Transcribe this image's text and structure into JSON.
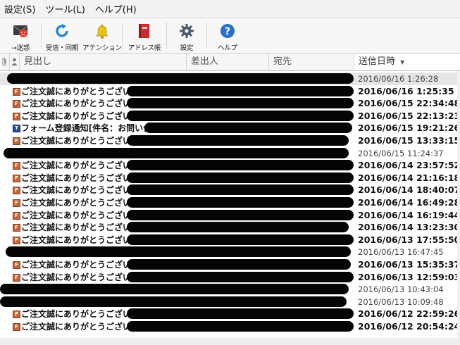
{
  "menu": [
    {
      "label": "設定(S)"
    },
    {
      "label": "ツール(L)"
    },
    {
      "label": "ヘルプ(H)"
    }
  ],
  "toolbar": [
    {
      "label": "→迷惑",
      "icon": "spam-mail-icon",
      "width": 58
    },
    {
      "label": "受信・同期",
      "icon": "sync-icon",
      "width": 58
    },
    {
      "label": "アテンション",
      "icon": "bell-icon",
      "width": 56
    },
    {
      "label": "アドレス帳",
      "icon": "address-book-icon",
      "width": 62
    },
    {
      "label": "設定",
      "icon": "gear-icon",
      "width": 56
    },
    {
      "label": "ヘルプ",
      "icon": "help-icon",
      "width": 58
    }
  ],
  "columns": {
    "subject": "見出し",
    "sender": "差出人",
    "recipient": "宛先",
    "date": "送信日時"
  },
  "messages": [
    {
      "subject": "",
      "date": "2016/06/16 1:26:28",
      "state": "read",
      "selected": true,
      "icon": "",
      "rx": 10,
      "rw": 492
    },
    {
      "subject": "ご注文誠にありがとうございます",
      "date": "2016/06/16 1:25:35",
      "state": "unread",
      "icon": "F",
      "rx": 180,
      "rw": 322
    },
    {
      "subject": "ご注文誠にありがとうございます",
      "date": "2016/06/15 22:34:48",
      "state": "unread",
      "icon": "F",
      "rx": 180,
      "rw": 322
    },
    {
      "subject": "ご注文誠にありがとうございます",
      "date": "2016/06/15 22:13:23",
      "state": "unread",
      "icon": "F",
      "rx": 180,
      "rw": 322
    },
    {
      "subject": "フォーム登録通知[件名：お問い合わ",
      "date": "2016/06/15 19:21:26",
      "state": "unread",
      "icon": "T",
      "rx": 205,
      "rw": 295
    },
    {
      "subject": "ご注文誠にありがとうございます",
      "date": "2016/06/15 13:33:15",
      "state": "unread",
      "icon": "F",
      "rx": 180,
      "rw": 315
    },
    {
      "subject": "",
      "date": "2016/06/15 11:24:37",
      "state": "read",
      "icon": "",
      "rx": 5,
      "rw": 490
    },
    {
      "subject": "ご注文誠にありがとうございます",
      "date": "2016/06/14 23:57:52",
      "state": "unread",
      "icon": "F",
      "rx": 180,
      "rw": 322
    },
    {
      "subject": "ご注文誠にありがとうございます",
      "date": "2016/06/14 21:16:18",
      "state": "unread",
      "icon": "F",
      "rx": 180,
      "rw": 322
    },
    {
      "subject": "ご注文誠にありがとうございます",
      "date": "2016/06/14 18:40:07",
      "state": "unread",
      "icon": "F",
      "rx": 180,
      "rw": 322
    },
    {
      "subject": "ご注文誠にありがとうございます",
      "date": "2016/06/14 16:49:28",
      "state": "unread",
      "icon": "F",
      "rx": 180,
      "rw": 322
    },
    {
      "subject": "ご注文誠にありがとうございます",
      "date": "2016/06/14 16:19:44",
      "state": "unread",
      "icon": "F",
      "rx": 180,
      "rw": 322
    },
    {
      "subject": "ご注文誠にありがとうございます",
      "date": "2016/06/14 13:23:30",
      "state": "unread",
      "icon": "F",
      "rx": 180,
      "rw": 315
    },
    {
      "subject": "ご注文誠にありがとうございます",
      "date": "2016/06/13 17:55:50",
      "state": "unread",
      "icon": "F",
      "rx": 180,
      "rw": 322
    },
    {
      "subject": "",
      "date": "2016/06/13 16:47:45",
      "state": "read",
      "icon": "",
      "rx": 8,
      "rw": 490
    },
    {
      "subject": "ご注文誠にありがとうございます",
      "date": "2016/06/13 15:35:37",
      "state": "unread",
      "icon": "F",
      "rx": 180,
      "rw": 318
    },
    {
      "subject": "ご注文誠にありがとうございます",
      "date": "2016/06/13 12:59:03",
      "state": "unread",
      "icon": "F",
      "rx": 180,
      "rw": 322
    },
    {
      "subject": "",
      "date": "2016/06/13 10:43:04",
      "state": "read",
      "icon": "",
      "rx": 0,
      "rw": 495
    },
    {
      "subject": "",
      "date": "2016/06/13 10:09:48",
      "state": "read",
      "icon": "",
      "rx": 0,
      "rw": 492
    },
    {
      "subject": "ご注文誠にありがとうございます",
      "date": "2016/06/12 22:59:26",
      "state": "unread",
      "icon": "F",
      "rx": 180,
      "rw": 322
    },
    {
      "subject": "ご注文誠にありがとうございます",
      "date": "2016/06/12 20:54:24",
      "state": "unread",
      "icon": "F",
      "rx": 180,
      "rw": 322
    }
  ]
}
